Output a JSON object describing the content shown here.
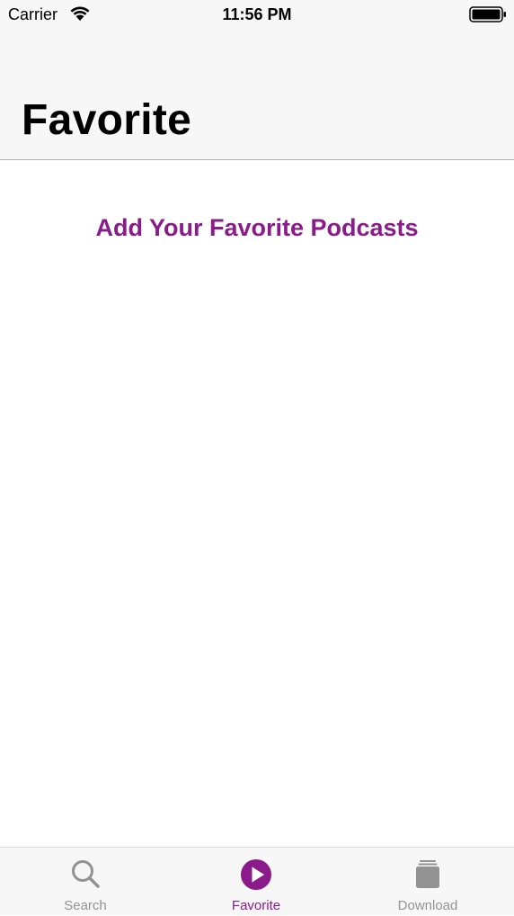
{
  "status_bar": {
    "carrier": "Carrier",
    "time": "11:56 PM"
  },
  "nav": {
    "title": "Favorite"
  },
  "main": {
    "empty_message": "Add Your Favorite Podcasts"
  },
  "tab_bar": {
    "tabs": [
      {
        "label": "Search",
        "icon": "search-icon",
        "active": false
      },
      {
        "label": "Favorite",
        "icon": "play-circle-icon",
        "active": true
      },
      {
        "label": "Download",
        "icon": "stack-icon",
        "active": false
      }
    ]
  },
  "colors": {
    "accent": "#8b1a8b",
    "inactive": "#929292"
  }
}
